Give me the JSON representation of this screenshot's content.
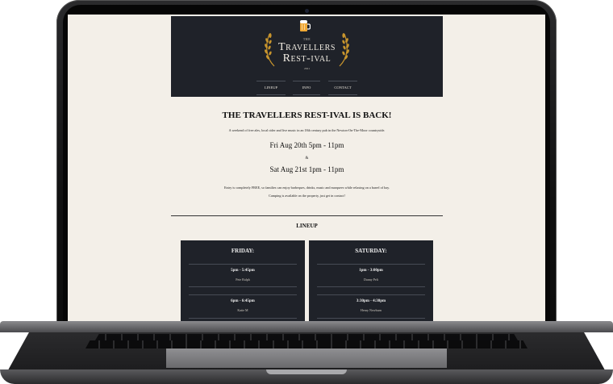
{
  "header": {
    "logo_the": "THE",
    "logo_line1": "Travellers",
    "logo_line2": "Rest-ival",
    "logo_year": "2021"
  },
  "nav": [
    "LINEUP",
    "INFO",
    "CONTACT"
  ],
  "main": {
    "title": "THE TRAVELLERS REST-IVAL IS BACK!",
    "intro": "A weekend of free ales, local cider and live music in an 18th century pub in the Newton-On-The-Moor countryside.",
    "date1": "Fri Aug 20th 5pm - 11pm",
    "amp": "&",
    "date2": "Sat Aug 21st 1pm - 11pm",
    "entry": "Entry is completely FREE, so families can enjoy barbeques, drinks, music and marquees while relaxing on a barrel of hay.",
    "camping": "Camping is available on the property, just get in contact!"
  },
  "lineup": {
    "heading": "LINEUP",
    "friday": {
      "title": "FRIDAY:",
      "slots": [
        {
          "time": "5pm - 5:45pm",
          "act": "Pete Ralph"
        },
        {
          "time": "6pm - 6:45pm",
          "act": "Katie M"
        }
      ]
    },
    "saturday": {
      "title": "SATURDAY:",
      "slots": [
        {
          "time": "1pm - 3:00pm",
          "act": "Danny Pelt"
        },
        {
          "time": "3:30pm - 4:30pm",
          "act": "Henry Newburn"
        }
      ]
    }
  },
  "colors": {
    "header_bg": "#1f2229",
    "page_bg": "#f3efe8",
    "accent_gold": "#c8952d"
  }
}
